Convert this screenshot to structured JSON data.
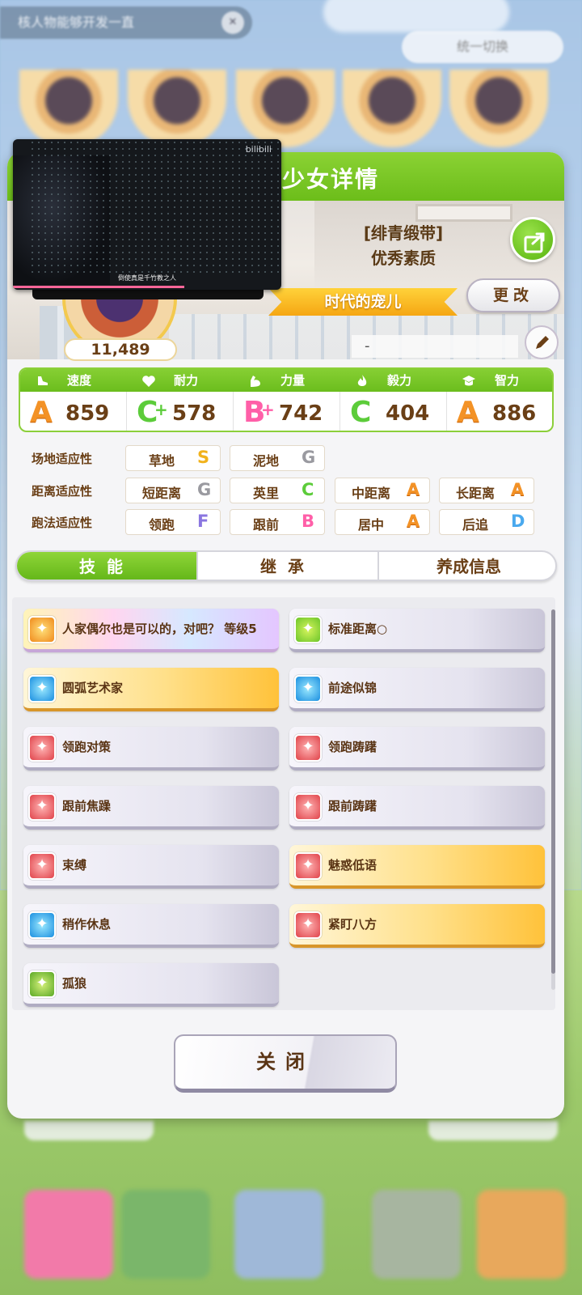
{
  "background": {
    "search_text": "核人物能够开发一直",
    "pill_text": "统一切换"
  },
  "panel": {
    "title": "少女详情"
  },
  "video": {
    "logo": "bilibili",
    "subtitle": "倒使真是千竹教之人",
    "progress": 0.64
  },
  "rank": {
    "line1": "[绯青缎带]",
    "line2": "优秀素质"
  },
  "ribbon_title": "时代的宠儿",
  "change_button": "更改",
  "name_value": "-",
  "score": "11,489",
  "stats": [
    {
      "label": "速度",
      "icon": "shoe-icon",
      "grade": "A",
      "plus": "",
      "value": "859"
    },
    {
      "label": "耐力",
      "icon": "heart-icon",
      "grade": "C",
      "plus": "+",
      "value": "578"
    },
    {
      "label": "力量",
      "icon": "muscle-icon",
      "grade": "B",
      "plus": "+",
      "value": "742"
    },
    {
      "label": "毅力",
      "icon": "flame-icon",
      "grade": "C",
      "plus": "",
      "value": "404"
    },
    {
      "label": "智力",
      "icon": "graduation-cap-icon",
      "grade": "A",
      "plus": "",
      "value": "886"
    }
  ],
  "aptitudes": {
    "track": {
      "label": "场地适应性",
      "items": [
        {
          "name": "草地",
          "grade": "S"
        },
        {
          "name": "泥地",
          "grade": "G"
        }
      ]
    },
    "distance": {
      "label": "距离适应性",
      "items": [
        {
          "name": "短距离",
          "grade": "G"
        },
        {
          "name": "英里",
          "grade": "C"
        },
        {
          "name": "中距离",
          "grade": "A"
        },
        {
          "name": "长距离",
          "grade": "A"
        }
      ]
    },
    "strategy": {
      "label": "跑法适应性",
      "items": [
        {
          "name": "领跑",
          "grade": "F"
        },
        {
          "name": "跟前",
          "grade": "B"
        },
        {
          "name": "居中",
          "grade": "A"
        },
        {
          "name": "后追",
          "grade": "D"
        }
      ]
    }
  },
  "tabs": [
    "技能",
    "继承",
    "养成信息"
  ],
  "skills": [
    {
      "name": "人家偶尔也是可以的，对吧？ 等级5",
      "style": "rainbow",
      "icon": "ic-orange"
    },
    {
      "name": "标准距离○",
      "style": "",
      "icon": "ic-green"
    },
    {
      "name": "圆弧艺术家",
      "style": "gold",
      "icon": "ic-blue"
    },
    {
      "name": "前途似锦",
      "style": "",
      "icon": "ic-blue"
    },
    {
      "name": "领跑对策",
      "style": "",
      "icon": "ic-red"
    },
    {
      "name": "领跑踌躇",
      "style": "",
      "icon": "ic-red"
    },
    {
      "name": "跟前焦躁",
      "style": "",
      "icon": "ic-red"
    },
    {
      "name": "跟前踌躇",
      "style": "",
      "icon": "ic-red"
    },
    {
      "name": "束缚",
      "style": "",
      "icon": "ic-red"
    },
    {
      "name": "魅惑低语",
      "style": "gold",
      "icon": "ic-red"
    },
    {
      "name": "稍作休息",
      "style": "",
      "icon": "ic-blue"
    },
    {
      "name": "紧盯八方",
      "style": "gold",
      "icon": "ic-red"
    },
    {
      "name": "孤狼",
      "style": "",
      "icon": "ic-lime"
    }
  ],
  "close_button": "关闭"
}
